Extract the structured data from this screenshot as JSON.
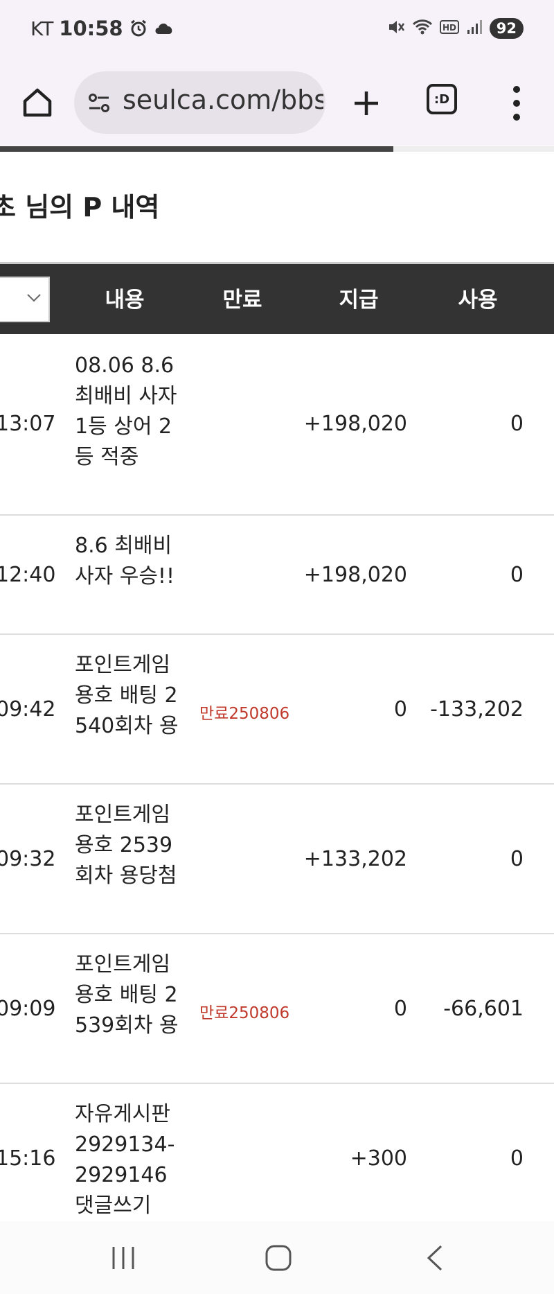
{
  "status_bar": {
    "carrier": "KT",
    "time": "10:58",
    "battery": "92"
  },
  "browser": {
    "url": "seulca.com/bbs",
    "tabs_label": ":D",
    "progress_percent": 71
  },
  "page": {
    "title": "초 님의 P 내역"
  },
  "table": {
    "headers": {
      "content": "내용",
      "expire": "만료",
      "pay": "지급",
      "use": "사용"
    },
    "rows": [
      {
        "time": "13:07",
        "content": "08.06 8.6 최배비 사자 1등 상어 2등 적중",
        "expire": "",
        "pay": "+198,020",
        "use": "0"
      },
      {
        "time": "12:40",
        "content": "8.6 최배비 사자 우승!!",
        "expire": "",
        "pay": "+198,020",
        "use": "0"
      },
      {
        "time": "09:42",
        "content": "포인트게임 용호 배팅 2540회차 용",
        "expire": "만료250806",
        "pay": "0",
        "use": "-133,202"
      },
      {
        "time": "09:32",
        "content": "포인트게임 용호 2539회차 용당첨",
        "expire": "",
        "pay": "+133,202",
        "use": "0"
      },
      {
        "time": "09:09",
        "content": "포인트게임 용호 배팅 2539회차 용",
        "expire": "만료250806",
        "pay": "0",
        "use": "-66,601"
      },
      {
        "time": "15:16",
        "content": "자유게시판 2929134-2929146 댓글쓰기",
        "expire": "",
        "pay": "+300",
        "use": "0"
      }
    ]
  },
  "icons": {
    "home": "home-icon",
    "site_settings": "site-settings-icon",
    "new_tab": "plus-icon",
    "menu": "more-vert-icon",
    "alarm": "alarm-icon",
    "mute": "mute-icon",
    "wifi": "wifi-icon",
    "signal": "signal-icon",
    "dropdown": "chevron-down-icon",
    "recent_apps": "recent-apps-icon",
    "nav_home": "nav-home-icon",
    "back": "back-icon"
  }
}
